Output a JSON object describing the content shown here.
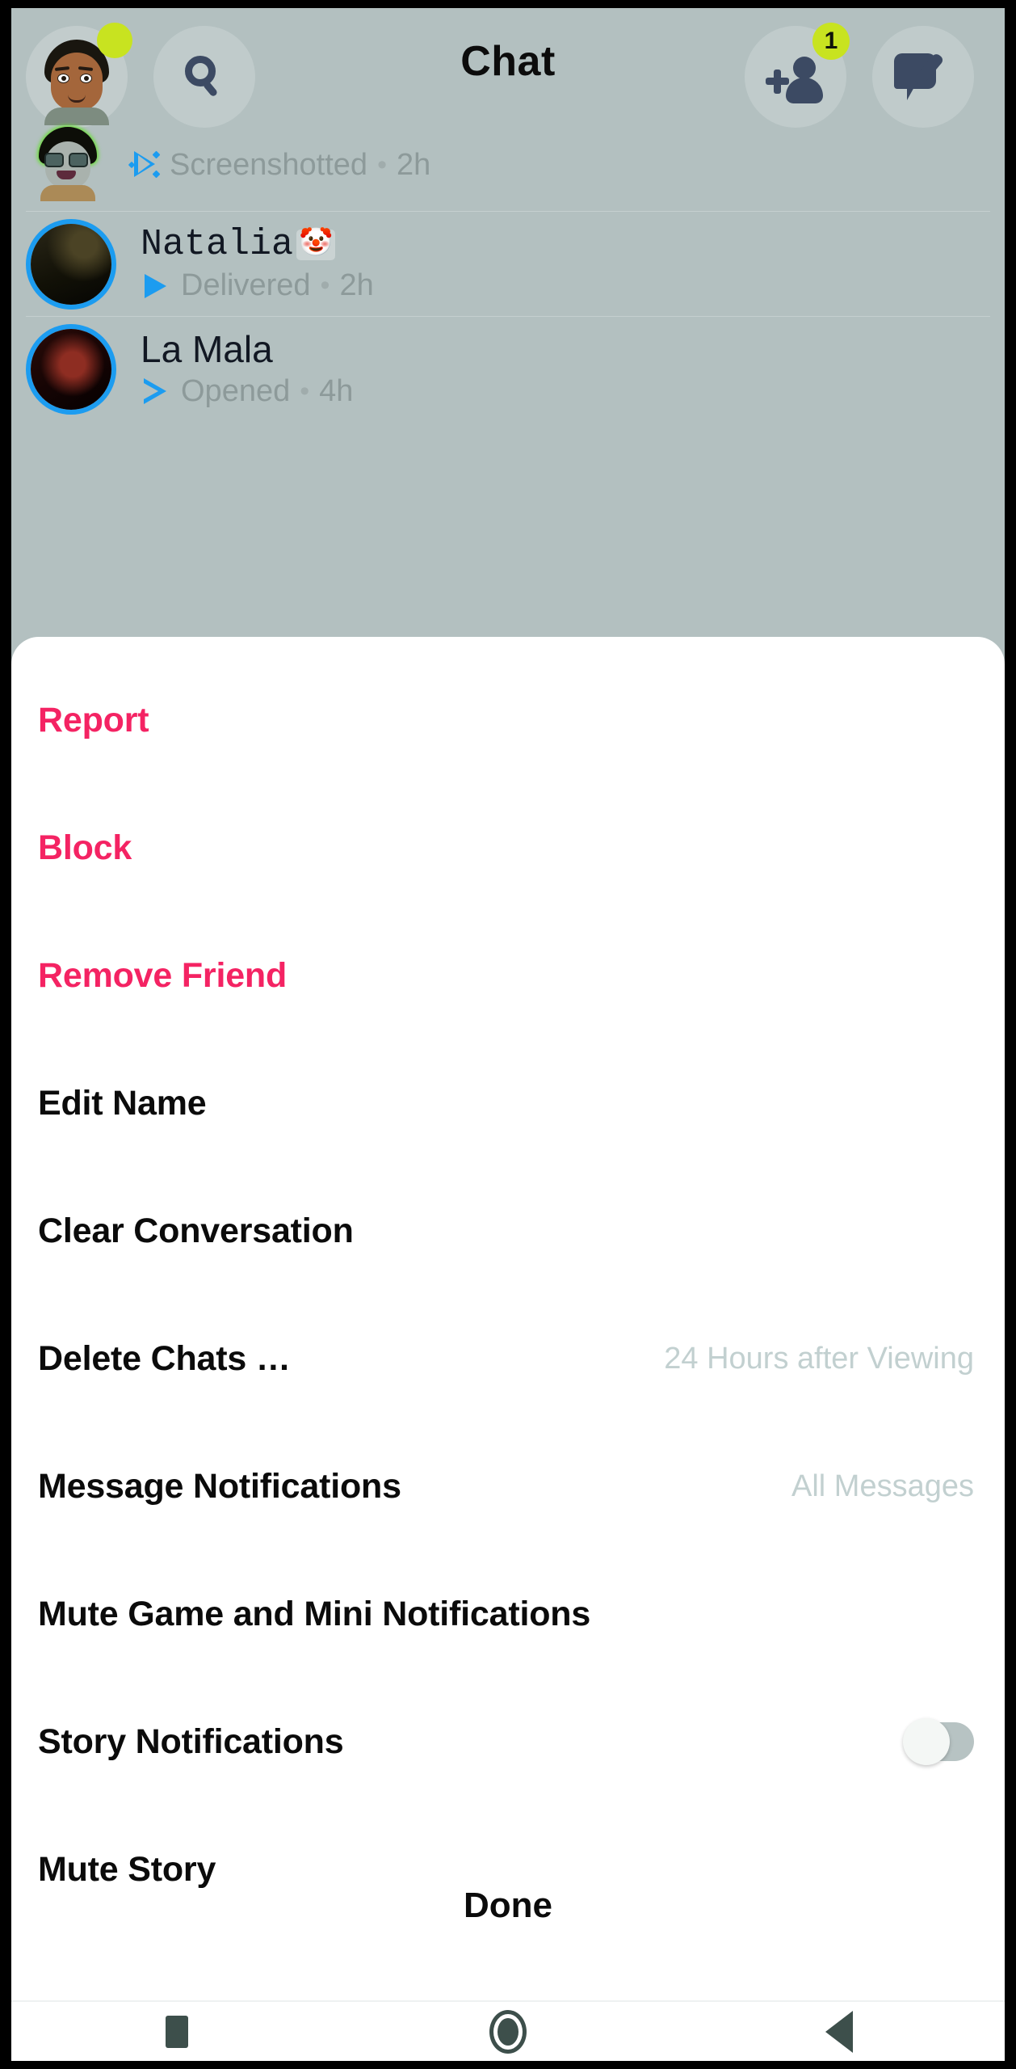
{
  "app": {
    "header": {
      "title": "Chat",
      "avatar_icon": "bitmoji-avatar-icon",
      "status_dot_color": "#c8e320",
      "search_icon": "search-icon",
      "add_friend_icon": "add-friend-icon",
      "add_friend_badge": "1",
      "new_chat_icon": "new-chat-icon"
    },
    "chat_list": [
      {
        "name": "",
        "name_emoji": "",
        "status": "Screenshotted",
        "status_icon": "screenshot-arrow-icon",
        "separator": "•",
        "time": "2h",
        "avatar_icon": "bitmoji-avatar-sunglasses-icon",
        "has_story_ring": false
      },
      {
        "name": "Natalia",
        "name_emoji": "🤡",
        "status": "Delivered",
        "status_icon": "filled-arrow-icon",
        "separator": "•",
        "time": "2h",
        "avatar_icon": "photo-avatar-icon",
        "has_story_ring": true
      },
      {
        "name": "La Mala",
        "name_emoji": "",
        "status": "Opened",
        "status_icon": "hollow-arrow-icon",
        "separator": "•",
        "time": "4h",
        "avatar_icon": "photo-avatar-icon",
        "has_story_ring": true
      }
    ]
  },
  "action_sheet": {
    "items": [
      {
        "label": "Report",
        "value": "",
        "style": "danger",
        "control": "none"
      },
      {
        "label": "Block",
        "value": "",
        "style": "danger",
        "control": "none"
      },
      {
        "label": "Remove Friend",
        "value": "",
        "style": "danger",
        "control": "none"
      },
      {
        "label": "Edit Name",
        "value": "",
        "style": "default",
        "control": "none"
      },
      {
        "label": "Clear Conversation",
        "value": "",
        "style": "default",
        "control": "none"
      },
      {
        "label": "Delete Chats …",
        "value": "24 Hours after Viewing",
        "style": "default",
        "control": "none"
      },
      {
        "label": "Message Notifications",
        "value": "All Messages",
        "style": "default",
        "control": "none"
      },
      {
        "label": "Mute Game and Mini Notifications",
        "value": "",
        "style": "default",
        "control": "none"
      },
      {
        "label": "Story Notifications",
        "value": "",
        "style": "default",
        "control": "toggle",
        "toggle_on": false
      },
      {
        "label": "Mute Story",
        "value": "",
        "style": "default",
        "control": "none"
      }
    ],
    "done_label": "Done"
  },
  "navbar": {
    "recents_icon": "square-recents-icon",
    "home_icon": "circle-home-icon",
    "back_icon": "triangle-back-icon"
  },
  "colors": {
    "danger": "#f42363",
    "accent_blue": "#1c9cf0",
    "accent_yellow": "#c8e320",
    "backdrop": "#b3c0c0",
    "sheet": "#ffffff",
    "value_text": "#c2d0d0"
  }
}
